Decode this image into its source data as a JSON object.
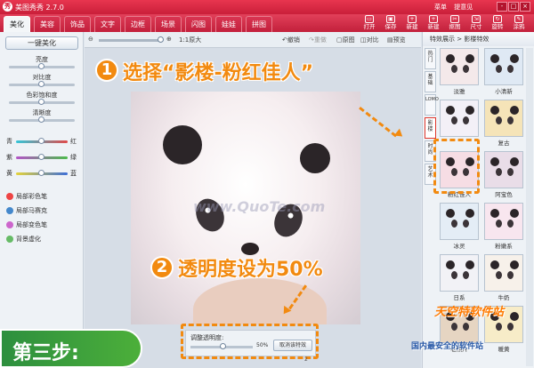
{
  "window": {
    "title": "美图秀秀 2.7.0",
    "logo_glyph": "秀",
    "menu_links": [
      "菜单",
      "提意见"
    ],
    "controls": [
      "-",
      "□",
      "×"
    ]
  },
  "tabs": [
    "美化",
    "美容",
    "饰品",
    "文字",
    "边框",
    "场景",
    "闪图",
    "娃娃",
    "拼图"
  ],
  "active_tab": "美化",
  "toolbar": [
    "打开",
    "保存",
    "新建",
    "新建",
    "抠图",
    "尺寸",
    "旋转",
    "涂鸦"
  ],
  "left_panel": {
    "one_click_label": "一键美化",
    "adjust": [
      {
        "label": "亮度",
        "value": 0.5
      },
      {
        "label": "对比度",
        "value": 0.5
      },
      {
        "label": "色彩饱和度",
        "value": 0.5
      },
      {
        "label": "清晰度",
        "value": 0.5
      }
    ],
    "color_sliders": [
      {
        "left": "青",
        "right": "红",
        "value": 0.5
      },
      {
        "left": "紫",
        "right": "绿",
        "value": 0.5
      },
      {
        "left": "黄",
        "right": "蓝",
        "value": 0.5
      }
    ],
    "brushes": [
      "局部彩色笔",
      "局部马赛克",
      "局部变色笔",
      "背景虚化"
    ]
  },
  "zoom_toolbar": {
    "zoom_text": "1:1原大",
    "undo": "撤销",
    "redo": "重做",
    "original": "原图",
    "compare": "对比",
    "preview": "预览"
  },
  "watermark": "www.QuoTe.com",
  "opacity": {
    "label": "调整透明度:",
    "value_text": "50%",
    "value": 0.5,
    "cancel_label": "取消该特效"
  },
  "right_panel": {
    "header": "特效展示 > 影楼特效",
    "vertical_tabs": [
      "热门",
      "基础",
      "LOMO",
      "影楼",
      "时尚",
      "艺术"
    ],
    "active_vtab": "影楼",
    "effects": [
      "淡雅",
      "小清新",
      "",
      "复古",
      "粉红佳人",
      "阿宝色",
      "冰灵",
      "粉嫩系",
      "日系",
      "牛奶",
      "老照片",
      "暖黄"
    ]
  },
  "annotations": {
    "step1_number": "1",
    "step1_text": "选择“影楼-粉红佳人”",
    "step2_number": "2",
    "step2_text": "透明度设为50%",
    "step_banner": "第三步:",
    "site_logo": "天空特软件站",
    "site_url": "国内最安全的软件站",
    "credit": "2"
  },
  "colors": {
    "title_red": "#d62642",
    "accent_orange": "#f28a10",
    "banner_green": "#3a9e3c"
  }
}
